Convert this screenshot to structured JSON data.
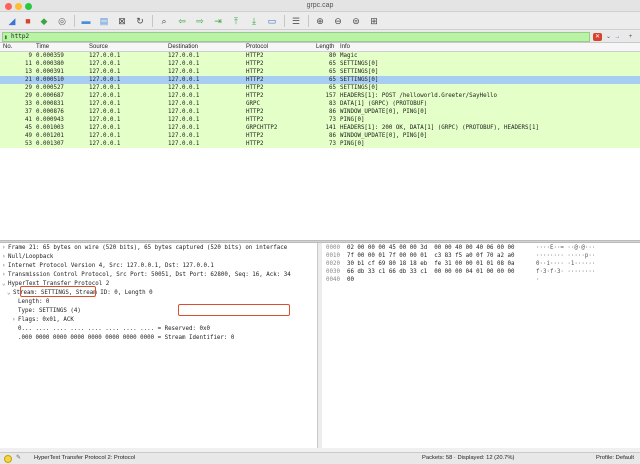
{
  "window": {
    "title": "grpc.cap"
  },
  "filter": {
    "value": "http2"
  },
  "columns": [
    "No.",
    "Time",
    "Source",
    "Destination",
    "Protocol",
    "Length",
    "Info"
  ],
  "packets": [
    {
      "no": "9",
      "time": "0.000359",
      "src": "127.0.0.1",
      "dst": "127.0.0.1",
      "proto": "HTTP2",
      "len": "80",
      "info": "Magic",
      "style": "http2"
    },
    {
      "no": "11",
      "time": "0.000380",
      "src": "127.0.0.1",
      "dst": "127.0.0.1",
      "proto": "HTTP2",
      "len": "65",
      "info": "SETTINGS[0]",
      "style": "http2"
    },
    {
      "no": "13",
      "time": "0.000391",
      "src": "127.0.0.1",
      "dst": "127.0.0.1",
      "proto": "HTTP2",
      "len": "65",
      "info": "SETTINGS[0]",
      "style": "http2"
    },
    {
      "no": "21",
      "time": "0.000510",
      "src": "127.0.0.1",
      "dst": "127.0.0.1",
      "proto": "HTTP2",
      "len": "65",
      "info": "SETTINGS[0]",
      "style": "selected"
    },
    {
      "no": "29",
      "time": "0.000527",
      "src": "127.0.0.1",
      "dst": "127.0.0.1",
      "proto": "HTTP2",
      "len": "65",
      "info": "SETTINGS[0]",
      "style": "http2"
    },
    {
      "no": "29",
      "time": "0.000687",
      "src": "127.0.0.1",
      "dst": "127.0.0.1",
      "proto": "HTTP2",
      "len": "157",
      "info": "HEADERS[1]: POST /helloworld.Greeter/SayHello",
      "style": "http2"
    },
    {
      "no": "33",
      "time": "0.000831",
      "src": "127.0.0.1",
      "dst": "127.0.0.1",
      "proto": "GRPC",
      "len": "83",
      "info": "DATA[1] (GRPC) (PROTOBUF)",
      "style": "http2"
    },
    {
      "no": "37",
      "time": "0.000876",
      "src": "127.0.0.1",
      "dst": "127.0.0.1",
      "proto": "HTTP2",
      "len": "86",
      "info": "WINDOW_UPDATE[0], PING[0]",
      "style": "http2"
    },
    {
      "no": "41",
      "time": "0.000943",
      "src": "127.0.0.1",
      "dst": "127.0.0.1",
      "proto": "HTTP2",
      "len": "73",
      "info": "PING[0]",
      "style": "http2"
    },
    {
      "no": "45",
      "time": "0.001003",
      "src": "127.0.0.1",
      "dst": "127.0.0.1",
      "proto": "GRPCHTTP2",
      "len": "141",
      "info": "HEADERS[1]: 200 OK, DATA[1] (GRPC) (PROTOBUF), HEADERS[1]",
      "style": "http2"
    },
    {
      "no": "49",
      "time": "0.001201",
      "src": "127.0.0.1",
      "dst": "127.0.0.1",
      "proto": "HTTP2",
      "len": "86",
      "info": "WINDOW_UPDATE[0], PING[0]",
      "style": "http2"
    },
    {
      "no": "53",
      "time": "0.001307",
      "src": "127.0.0.1",
      "dst": "127.0.0.1",
      "proto": "HTTP2",
      "len": "73",
      "info": "PING[0]",
      "style": "http2"
    }
  ],
  "details": [
    {
      "indent": 0,
      "tri": "›",
      "text": "Frame 21: 65 bytes on wire (520 bits), 65 bytes captured (520 bits) on interface"
    },
    {
      "indent": 0,
      "tri": "›",
      "text": "Null/Loopback"
    },
    {
      "indent": 0,
      "tri": "›",
      "text": "Internet Protocol Version 4, Src: 127.0.0.1, Dst: 127.0.0.1"
    },
    {
      "indent": 0,
      "tri": "›",
      "text": "Transmission Control Protocol, Src Port: 50051, Dst Port: 62800, Seq: 16, Ack: 34"
    },
    {
      "indent": 0,
      "tri": "⌄",
      "text": "HyperText Transfer Protocol 2"
    },
    {
      "indent": 1,
      "tri": "⌄",
      "text": "Stream: SETTINGS, Stream ID: 0, Length 0"
    },
    {
      "indent": 2,
      "tri": "",
      "text": "Length: 0"
    },
    {
      "indent": 2,
      "tri": "",
      "text": "Type: SETTINGS (4)"
    },
    {
      "indent": 2,
      "tri": "›",
      "text": "Flags: 0x01, ACK"
    },
    {
      "indent": 2,
      "tri": "",
      "text": "0... .... .... .... .... .... .... .... = Reserved: 0x0"
    },
    {
      "indent": 2,
      "tri": "",
      "text": ".000 0000 0000 0000 0000 0000 0000 0000 = Stream Identifier: 0"
    }
  ],
  "hex": [
    {
      "off": "0000",
      "bytes": "02 00 00 00 45 00 00 3d  00 00 40 00 40 06 00 00",
      "ascii": "····E··= ··@·@···"
    },
    {
      "off": "0010",
      "bytes": "7f 00 00 01 7f 00 00 01  c3 83 f5 a0 0f 70 a2 a0",
      "ascii": "········ ·····p··"
    },
    {
      "off": "0020",
      "bytes": "30 b1 cf 69 80 18 18 eb  fe 31 00 00 01 01 08 0a",
      "ascii": "0··i···· ·1······"
    },
    {
      "off": "0030",
      "bytes": "66 db 33 c1 66 db 33 c1  00 00 00 04 01 00 00 00",
      "ascii": "f·3·f·3· ········"
    },
    {
      "off": "0040",
      "bytes": "00",
      "ascii": "·"
    }
  ],
  "status": {
    "left": "HyperText Transfer Protocol 2: Protocol",
    "packets": "Packets: 58 · Displayed: 12 (20.7%)",
    "profile": "Profile: Default"
  },
  "colors": {
    "http2_row": "#e4ffc7",
    "selected_row": "#a8cdf3",
    "filter_ok": "#b7f5a4",
    "highlight": "#d9502f"
  }
}
